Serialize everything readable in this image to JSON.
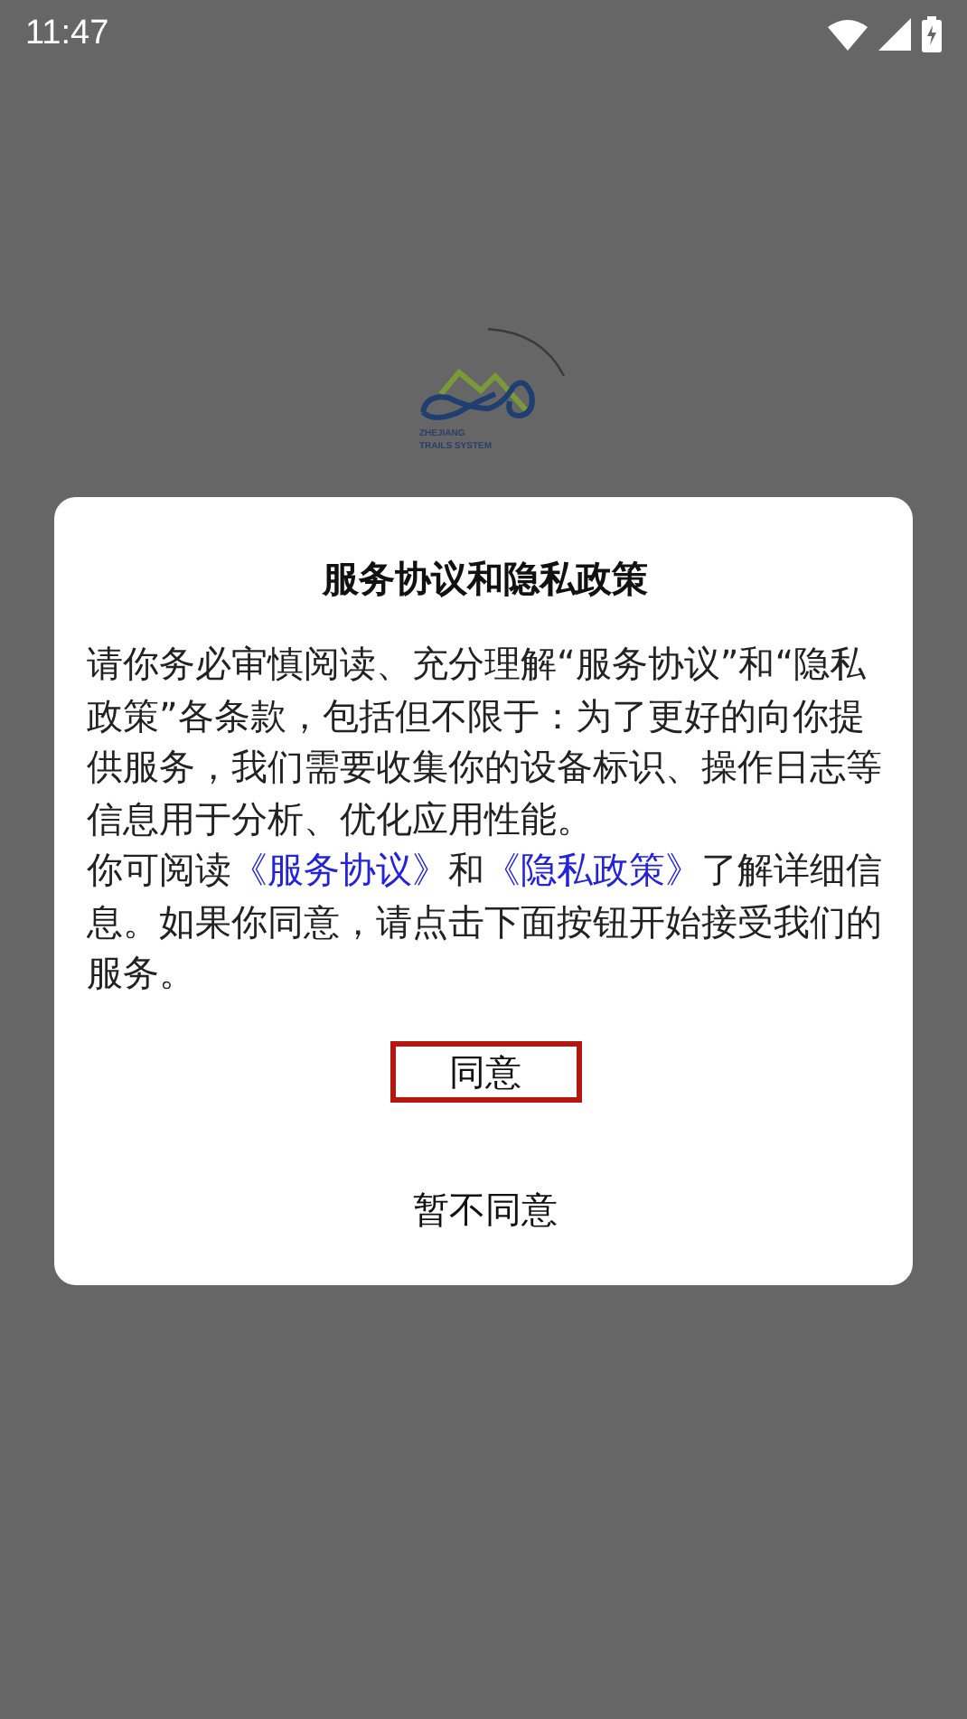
{
  "status_bar": {
    "time": "11:47"
  },
  "splash": {
    "logo_lines": [
      "ZHEJIANG",
      "TRAILS SYSTEM"
    ]
  },
  "dialog": {
    "title": "服务协议和隐私政策",
    "paragraphs": [
      [
        {
          "kind": "text",
          "text": "请你务必审慎阅读、充分理解“服务协议”和“隐私政策”各条款，包括但不限于：为了更好的向你提供服务，我们需要收集你的设备标识、操作日志等信息用于分析、优化应用性能。"
        }
      ],
      [
        {
          "kind": "text",
          "text": "你可阅读"
        },
        {
          "kind": "link",
          "text": "《服务协议》"
        },
        {
          "kind": "text",
          "text": "和"
        },
        {
          "kind": "link",
          "text": "《隐私政策》"
        },
        {
          "kind": "text",
          "text": "了解详细信息。如果你同意，请点击下面按钮开始接受我们的服务。"
        }
      ]
    ],
    "buttons": [
      {
        "label": "同意",
        "highlighted": true
      },
      {
        "label": "暂不同意",
        "highlighted": false
      }
    ]
  }
}
